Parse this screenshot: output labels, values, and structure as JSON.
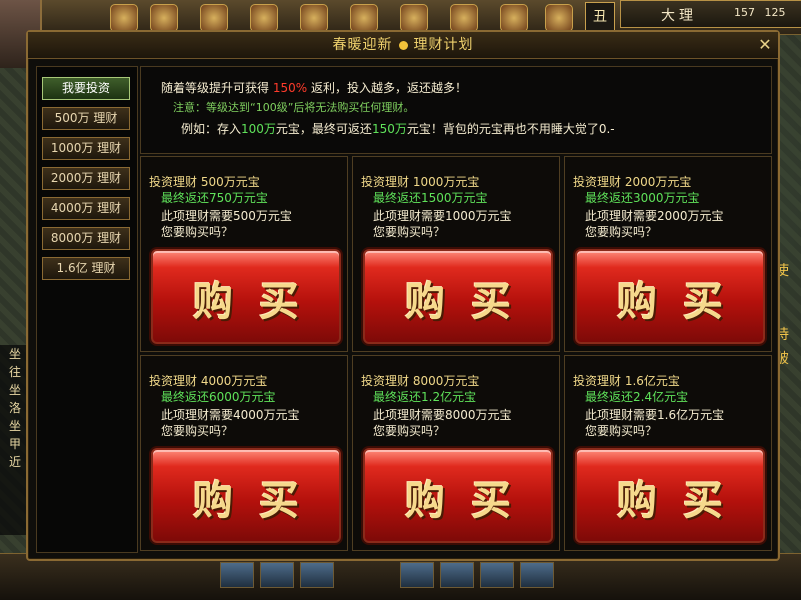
{
  "hud": {
    "zone_name": "大理",
    "coords": "157 125",
    "calendar_glyph": "丑",
    "chat_glyphs": [
      "坐",
      "往",
      "坐",
      "洛",
      "坐",
      "甲",
      "近"
    ],
    "right_glyphs": [
      "使",
      "待",
      "破"
    ]
  },
  "panel": {
    "title_left": "春暖迎新",
    "title_right": "理财计划",
    "close_glyph": "✕"
  },
  "sidebar": {
    "items": [
      {
        "label": "我要投资",
        "active": true
      },
      {
        "label": "500万 理财"
      },
      {
        "label": "1000万 理财"
      },
      {
        "label": "2000万 理财"
      },
      {
        "label": "4000万 理财"
      },
      {
        "label": "8000万 理财"
      },
      {
        "label": "1.6亿 理财"
      }
    ]
  },
  "info": {
    "line1_a": "随着等级提升可获得 ",
    "line1_pct": "150%",
    "line1_b": " 返利，投入越多，返还越多！",
    "line2": "注意：等级达到“100级”后将无法购买任何理财。",
    "line3_a": "例如：存入",
    "line3_v1": "100万",
    "line3_b": "元宝，最终可返还",
    "line3_v2": "150万",
    "line3_c": "元宝！背包的元宝再也不用睡大觉了0.-"
  },
  "cards": [
    {
      "title": "投资理财 500万元宝",
      "return": "最终返还750万元宝",
      "need": "此项理财需要500万元宝",
      "ask": "您要购买吗？",
      "buy": "购买"
    },
    {
      "title": "投资理财 1000万元宝",
      "return": "最终返还1500万元宝",
      "need": "此项理财需要1000万元宝",
      "ask": "您要购买吗？",
      "buy": "购买"
    },
    {
      "title": "投资理财 2000万元宝",
      "return": "最终返还3000万元宝",
      "need": "此项理财需要2000万元宝",
      "ask": "您要购买吗？",
      "buy": "购买"
    },
    {
      "title": "投资理财 4000万元宝",
      "return": "最终返还6000万元宝",
      "need": "此项理财需要4000万元宝",
      "ask": "您要购买吗？",
      "buy": "购买"
    },
    {
      "title": "投资理财 8000万元宝",
      "return": "最终返还1.2亿元宝",
      "need": "此项理财需要8000万元宝",
      "ask": "您要购买吗？",
      "buy": "购买"
    },
    {
      "title": "投资理财 1.6亿元宝",
      "return": "最终返还2.4亿元宝",
      "need": "此项理财需要1.6亿万元宝",
      "ask": "您要购买吗？",
      "buy": "购买"
    }
  ],
  "colors": {
    "accent_gold": "#f0d26e",
    "return_green": "#5fe25a",
    "pct_red": "#ff3b2b",
    "button_red": "#b5110c"
  }
}
